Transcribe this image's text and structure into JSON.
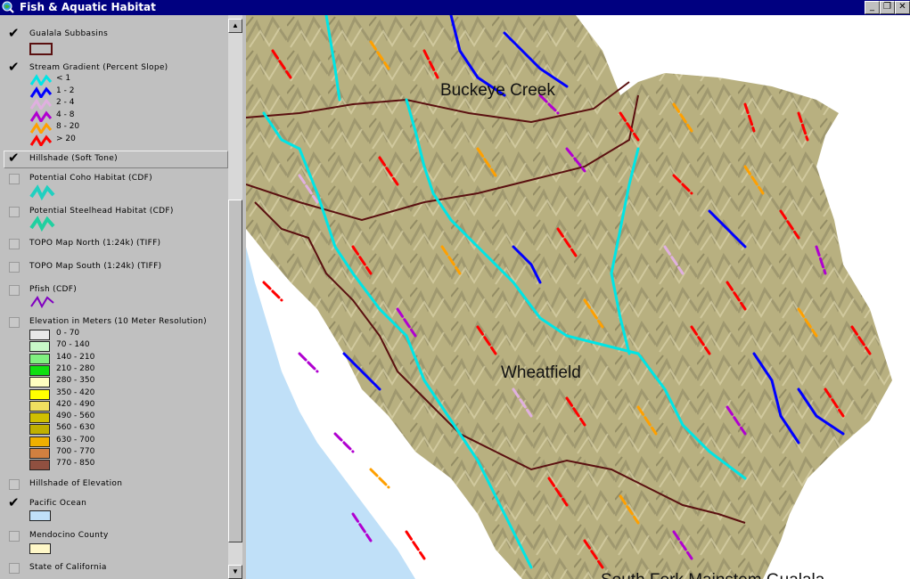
{
  "window": {
    "title": "Fish & Aquatic Habitat",
    "buttons": [
      "minimize",
      "restore",
      "close"
    ],
    "icons": {
      "app": "globe-icon"
    }
  },
  "legend": {
    "layers": [
      {
        "name": "Gualala Subbasins",
        "checked": true,
        "symbol": "polygon-outline",
        "color": "#5a1010"
      },
      {
        "name": "Stream Gradient (Percent Slope)",
        "checked": true,
        "classes": [
          {
            "label": "< 1",
            "color": "#00e5e5"
          },
          {
            "label": "1 - 2",
            "color": "#0000ff"
          },
          {
            "label": "2 - 4",
            "color": "#e0b0e0"
          },
          {
            "label": "4 - 8",
            "color": "#b000d0"
          },
          {
            "label": "8 - 20",
            "color": "#ffa000"
          },
          {
            "label": "> 20",
            "color": "#ff0000"
          }
        ]
      },
      {
        "name": "Hillshade (Soft Tone)",
        "checked": true,
        "selected": true
      },
      {
        "name": "Potential Coho Habitat (CDF)",
        "checked": false,
        "color": "#20d0c0"
      },
      {
        "name": "Potential Steelhead Habitat (CDF)",
        "checked": false,
        "color": "#20d0a0"
      },
      {
        "name": "TOPO Map North (1:24k) (TIFF)",
        "checked": false
      },
      {
        "name": "TOPO Map South (1:24k) (TIFF)",
        "checked": false
      },
      {
        "name": "Pfish (CDF)",
        "checked": false,
        "color": "#8000c0"
      },
      {
        "name": "Elevation in Meters (10 Meter Resolution)",
        "checked": false,
        "classes": [
          {
            "label": "0 - 70",
            "color": "#e8e8e8"
          },
          {
            "label": "70 - 140",
            "color": "#c8f8c8"
          },
          {
            "label": "140 - 210",
            "color": "#80f080"
          },
          {
            "label": "210 - 280",
            "color": "#10e010"
          },
          {
            "label": "280 - 350",
            "color": "#ffffc0"
          },
          {
            "label": "350 - 420",
            "color": "#ffff00"
          },
          {
            "label": "420 - 490",
            "color": "#f0e060"
          },
          {
            "label": "490 - 560",
            "color": "#d0c000"
          },
          {
            "label": "560 - 630",
            "color": "#c0b000"
          },
          {
            "label": "630 - 700",
            "color": "#f0b000"
          },
          {
            "label": "700 - 770",
            "color": "#d08040"
          },
          {
            "label": "770 - 850",
            "color": "#905040"
          }
        ]
      },
      {
        "name": "Hillshade of Elevation",
        "checked": false
      },
      {
        "name": "Pacific Ocean",
        "checked": true,
        "color": "#c0e0f8"
      },
      {
        "name": "Mendocino County",
        "checked": false,
        "color": "#fff8c8"
      },
      {
        "name": "State of California",
        "checked": false
      }
    ]
  },
  "map": {
    "labels": [
      "Buckeye Creek",
      "Wheatfield",
      "South Fork Mainstem Gualala"
    ],
    "colors": {
      "ocean": "#c0e0f8",
      "coast": "#ffffff",
      "terrain": "#b8b080",
      "terrain_shade": "#8a8460",
      "subbasin_boundary": "#5a1010"
    }
  }
}
